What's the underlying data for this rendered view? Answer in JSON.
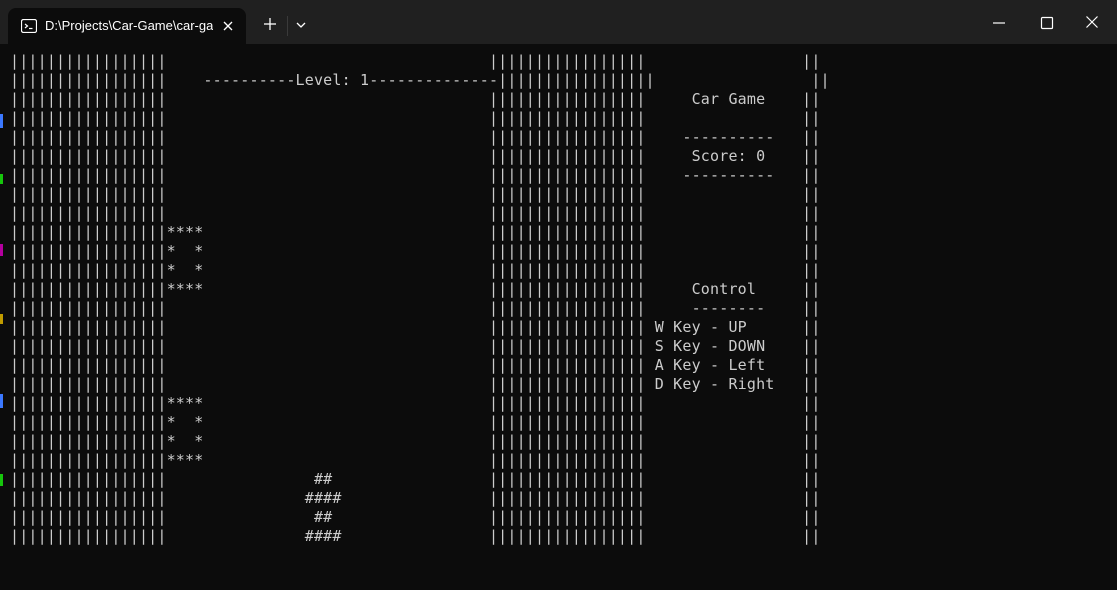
{
  "window": {
    "tab_title": "D:\\Projects\\Car-Game\\car-ga",
    "tab_icon": "terminal-icon"
  },
  "colors": {
    "terminal_background": "#0c0c0c",
    "titlebar_background": "#202020",
    "text": "#cccccc"
  },
  "game": {
    "level_line": "----------Level: 1--------------",
    "info_title": "Car Game",
    "dash_line": "----------",
    "score_line": "Score: 0",
    "control_title": "Control",
    "control_underline": "--------",
    "controls": [
      "W Key - UP",
      "S Key - DOWN",
      "A Key - Left",
      "D Key - Right"
    ]
  },
  "terminal_lines": [
    "|||||||||||||||||                                   |||||||||||||||||                 ||",
    "|||||||||||||||||    ----------Level: 1--------------|||||||||||||||||                 ||",
    "|||||||||||||||||                                   |||||||||||||||||     Car Game    ||",
    "|||||||||||||||||                                   |||||||||||||||||                 ||",
    "|||||||||||||||||                                   |||||||||||||||||    ----------   ||",
    "|||||||||||||||||                                   |||||||||||||||||     Score: 0    ||",
    "|||||||||||||||||                                   |||||||||||||||||    ----------   ||",
    "|||||||||||||||||                                   |||||||||||||||||                 ||",
    "|||||||||||||||||                                   |||||||||||||||||                 ||",
    "|||||||||||||||||****                               |||||||||||||||||                 ||",
    "|||||||||||||||||*  *                               |||||||||||||||||                 ||",
    "|||||||||||||||||*  *                               |||||||||||||||||                 ||",
    "|||||||||||||||||****                               |||||||||||||||||     Control     ||",
    "|||||||||||||||||                                   |||||||||||||||||     --------    ||",
    "|||||||||||||||||                                   ||||||||||||||||| W Key - UP      ||",
    "|||||||||||||||||                                   ||||||||||||||||| S Key - DOWN    ||",
    "|||||||||||||||||                                   ||||||||||||||||| A Key - Left    ||",
    "|||||||||||||||||                                   ||||||||||||||||| D Key - Right   ||",
    "|||||||||||||||||****                               |||||||||||||||||                 ||",
    "|||||||||||||||||*  *                               |||||||||||||||||                 ||",
    "|||||||||||||||||*  *                               |||||||||||||||||                 ||",
    "|||||||||||||||||****                               |||||||||||||||||                 ||",
    "|||||||||||||||||                ##                 |||||||||||||||||                 ||",
    "|||||||||||||||||               ####                |||||||||||||||||                 ||",
    "|||||||||||||||||                ##                 |||||||||||||||||                 ||",
    "|||||||||||||||||               ####                |||||||||||||||||                 ||"
  ]
}
